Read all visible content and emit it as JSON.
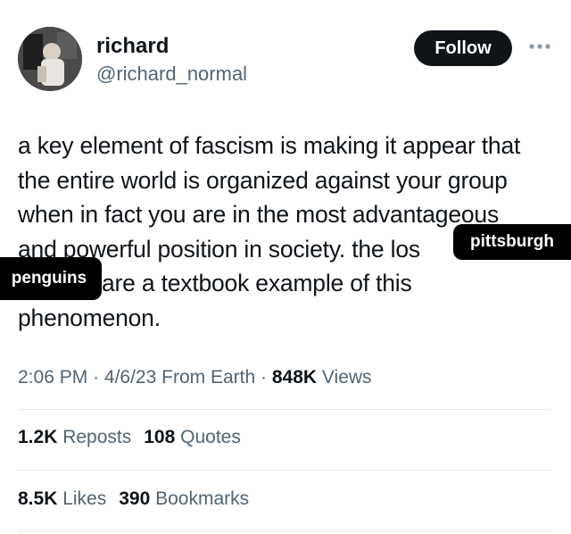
{
  "user": {
    "display_name": "richard",
    "handle": "@richard_normal"
  },
  "actions": {
    "follow_label": "Follow",
    "more_icon": "more-horizontal-icon"
  },
  "tweet": {
    "lines": [
      "a key element of fascism is making it appear that",
      "the entire world is organized against your group",
      "when in fact you are in the most advantageous",
      "and powerful position in society. the los",
      "are a textbook example of this",
      "phenomenon."
    ]
  },
  "overlays": {
    "right": "pittsburgh",
    "left": "penguins"
  },
  "meta": {
    "time": "2:06 PM",
    "date": "4/6/23",
    "source": "From Earth",
    "views_count": "848K",
    "views_label": "Views",
    "separator": "·"
  },
  "stats": {
    "reposts_count": "1.2K",
    "reposts_label": "Reposts",
    "quotes_count": "108",
    "quotes_label": "Quotes",
    "likes_count": "8.5K",
    "likes_label": "Likes",
    "bookmarks_count": "390",
    "bookmarks_label": "Bookmarks"
  },
  "colors": {
    "text": "#0f1419",
    "secondary": "#536471",
    "follow_bg": "#0f1419",
    "divider": "#e6e9ec"
  }
}
